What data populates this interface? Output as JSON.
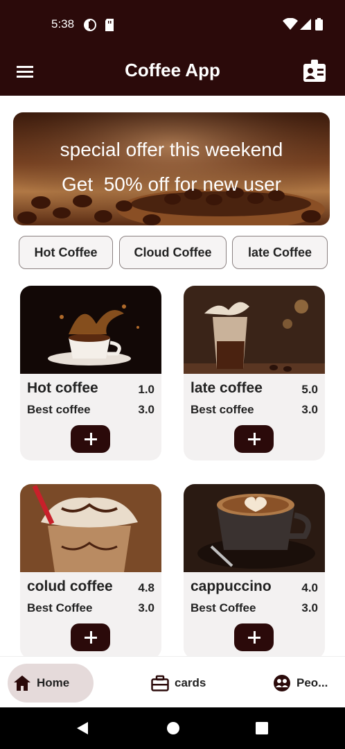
{
  "status": {
    "time": "5:38"
  },
  "app": {
    "title": "Coffee App"
  },
  "banner": {
    "line1": "special offer this weekend",
    "line2": "Get  50% off for new user"
  },
  "categories": [
    "Hot Coffee",
    "Cloud Coffee",
    "late Coffee"
  ],
  "products": [
    {
      "name": "Hot coffee",
      "rating": "1.0",
      "subtitle": "Best coffee",
      "price": "3.0"
    },
    {
      "name": "late coffee",
      "rating": "5.0",
      "subtitle": "Best coffee",
      "price": "3.0"
    },
    {
      "name": "colud coffee",
      "rating": "4.8",
      "subtitle": "Best Coffee",
      "price": "3.0"
    },
    {
      "name": "cappuccino",
      "rating": "4.0",
      "subtitle": "Best Coffee",
      "price": "3.0"
    }
  ],
  "nav": {
    "home": "Home",
    "cards": "cards",
    "people": "Peo..."
  },
  "colors": {
    "brand": "#2b0a0a",
    "chip_bg": "#f6f4f4",
    "card_bg": "#f3f1f1",
    "nav_active": "#e5dada"
  }
}
